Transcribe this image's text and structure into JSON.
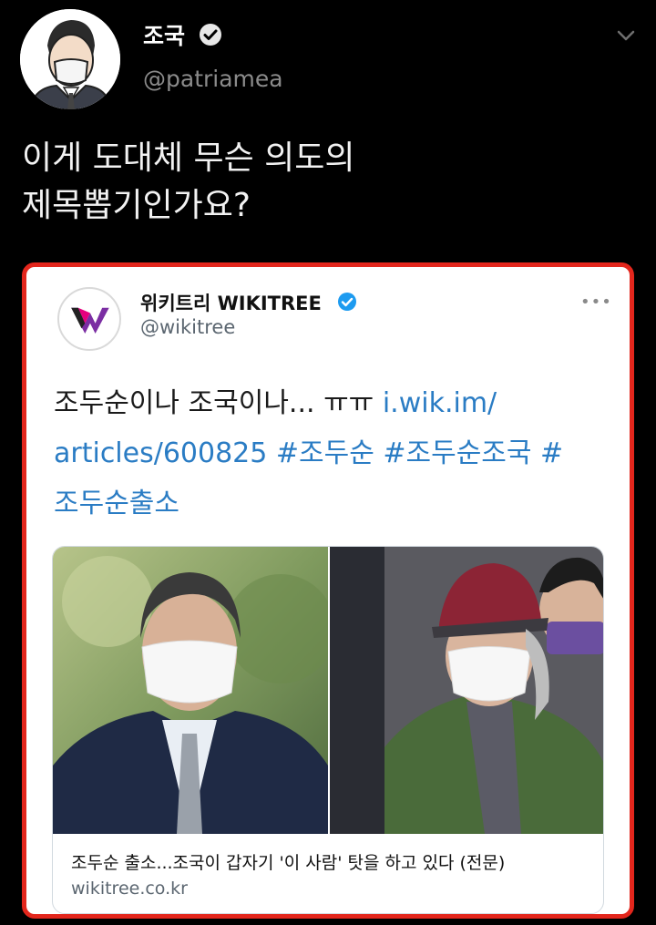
{
  "author": {
    "name": "조국",
    "handle": "@patriamea"
  },
  "tweet": {
    "line1": "이게 도대체 무슨 의도의",
    "line2": "제목뽑기인가요?"
  },
  "quoted": {
    "name": "위키트리 WIKITREE",
    "handle": "@wikitree",
    "more": "•••",
    "text_plain": "조두순이나 조국이나... ㅠㅠ ",
    "link1": "i.wik.im/",
    "link2": "articles/600825 #조두순 #조두순조국 #",
    "link3": "조두순출소",
    "card": {
      "title": "조두순 출소...조국이 갑자기 '이 사람' 탓을 하고 있다 (전문)",
      "domain": "wikitree.co.kr"
    }
  },
  "colors": {
    "background": "#000000",
    "highlight_border": "#e3261c",
    "link": "#2a7cc4",
    "verified_badge": "#1d9bf0"
  },
  "icons": [
    "verified-badge-icon",
    "chevron-down-icon",
    "more-dots-icon",
    "wikitree-logo"
  ]
}
